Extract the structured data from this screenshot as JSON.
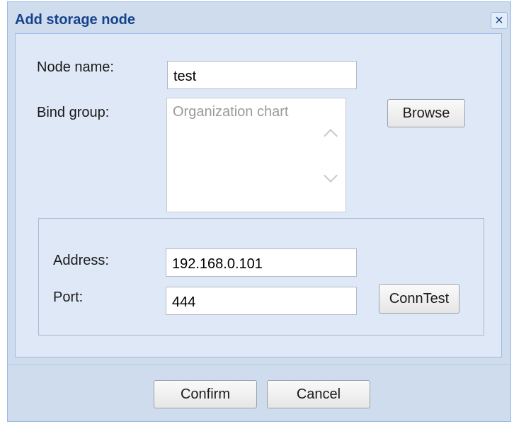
{
  "dialog": {
    "title": "Add storage node",
    "close_icon": "close-icon"
  },
  "form": {
    "node_name_label": "Node name:",
    "node_name_value": "test",
    "bind_group_label": "Bind group:",
    "bind_group_placeholder": "Organization chart",
    "browse_label": "Browse",
    "address_label": "Address:",
    "address_value": "192.168.0.101",
    "port_label": "Port:",
    "port_value": "444",
    "conntest_label": "ConnTest"
  },
  "footer": {
    "confirm_label": "Confirm",
    "cancel_label": "Cancel"
  },
  "colors": {
    "title": "#15428b",
    "dialog_bg": "#cfdcee",
    "panel_bg": "#dfe8f6",
    "border": "#99bbe8"
  }
}
